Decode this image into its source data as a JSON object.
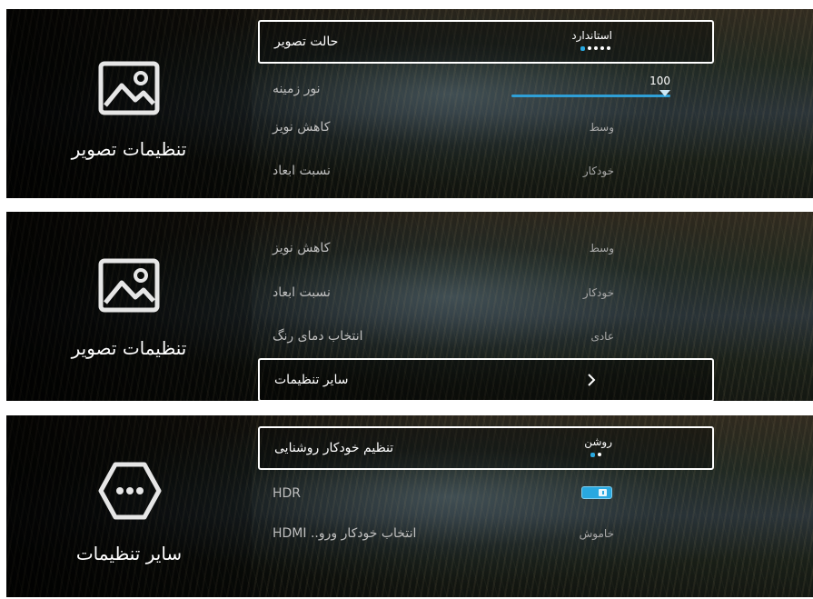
{
  "panel1": {
    "sidebar": {
      "icon": "image-icon",
      "title": "تنظیمات تصویر"
    },
    "rows": [
      {
        "label": "حالت تصویر",
        "value": "استاندارد",
        "focused": true,
        "dots_total": 5,
        "dots_active": 1
      },
      {
        "label": "نور زمینه",
        "slider_value": "100",
        "slider_fraction": 1.0
      },
      {
        "label": "کاهش نویز",
        "value": "وسط"
      },
      {
        "label": "نسبت ابعاد",
        "value": "خودکار"
      }
    ]
  },
  "panel2": {
    "sidebar": {
      "icon": "image-icon",
      "title": "تنظیمات تصویر"
    },
    "rows": [
      {
        "label": "کاهش نویز",
        "value": "وسط"
      },
      {
        "label": "نسبت ابعاد",
        "value": "خودکار"
      },
      {
        "label": "انتخاب دمای رنگ",
        "value": "عادی"
      },
      {
        "label": "سایر تنظیمات",
        "focused": true,
        "icon": "chevron-right-icon"
      }
    ]
  },
  "panel3": {
    "sidebar": {
      "icon": "more-dots-icon",
      "title": "سایر تنظیمات"
    },
    "rows": [
      {
        "label": "تنظیم خودکار روشنایی",
        "value": "روشن",
        "focused": true,
        "dots_total": 2,
        "dots_active": 1
      },
      {
        "label": "HDR",
        "toggle": "on"
      },
      {
        "label": "انتخاب خودکار ورو.. HDMI",
        "value": "خاموش"
      }
    ]
  },
  "colors": {
    "accent": "#29a8e0",
    "focus_border": "#ffffff",
    "label": "#bfbfbf"
  }
}
